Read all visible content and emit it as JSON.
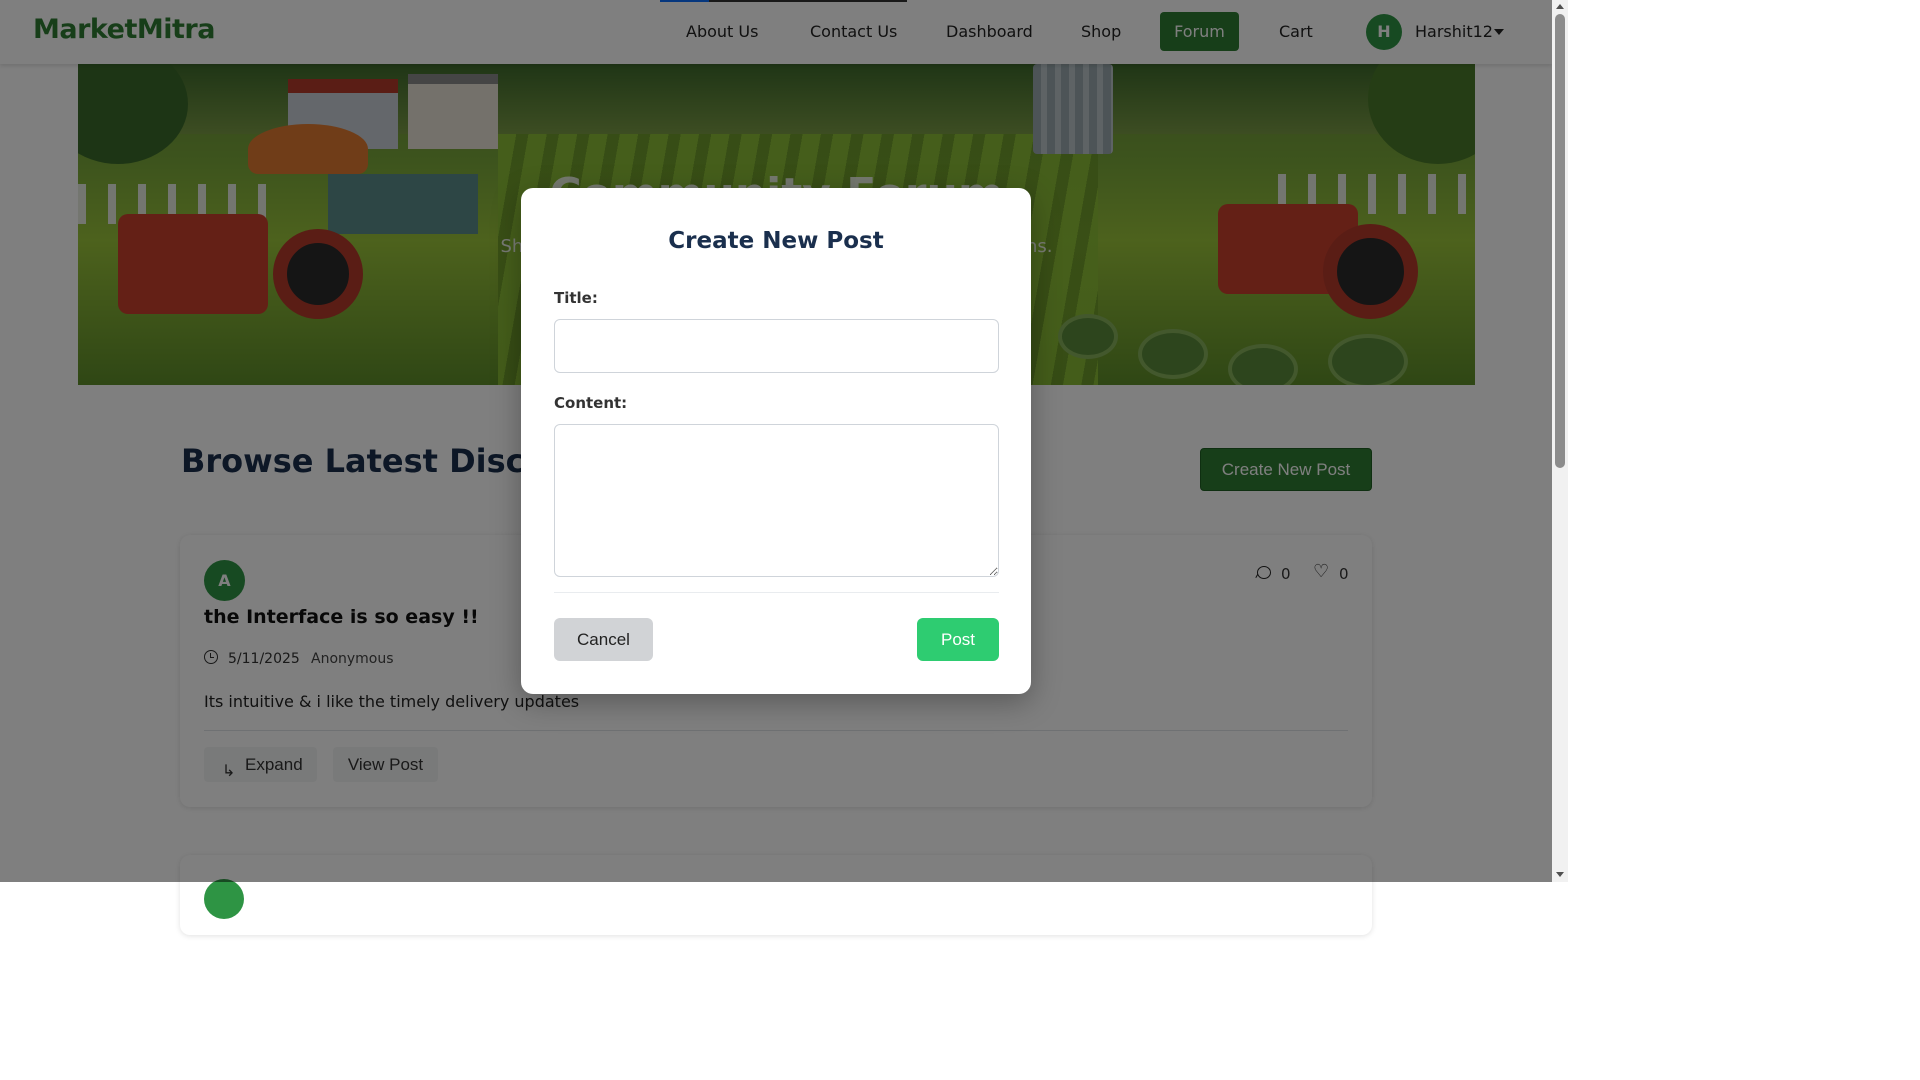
{
  "navbar": {
    "brand": "MarketMitra",
    "links": [
      "About Us",
      "Contact Us",
      "Dashboard",
      "Shop",
      "Forum",
      "Cart"
    ],
    "active_link": "Forum",
    "user_initial": "H",
    "username": "Harshit12",
    "brand_color": "#2e7d32"
  },
  "hero": {
    "title": "Community Forum",
    "subtitle": "Sha                                                                                    ons."
  },
  "main": {
    "section_title": "Browse Latest Discussi",
    "create_button": "Create New Post"
  },
  "posts": [
    {
      "avatar_initial": "A",
      "title": "the Interface is so easy !!",
      "date": "5/11/2025",
      "author": "Anonymous",
      "body": "Its intuitive & i like the timely delivery updates",
      "comments": "0",
      "likes": "0",
      "expand_label": "Expand",
      "view_label": "View Post"
    }
  ],
  "modal": {
    "title": "Create New Post",
    "title_label": "Title:",
    "title_value": "",
    "content_label": "Content:",
    "content_value": "",
    "cancel_label": "Cancel",
    "post_label": "Post",
    "post_button_color": "#2ecc71"
  }
}
